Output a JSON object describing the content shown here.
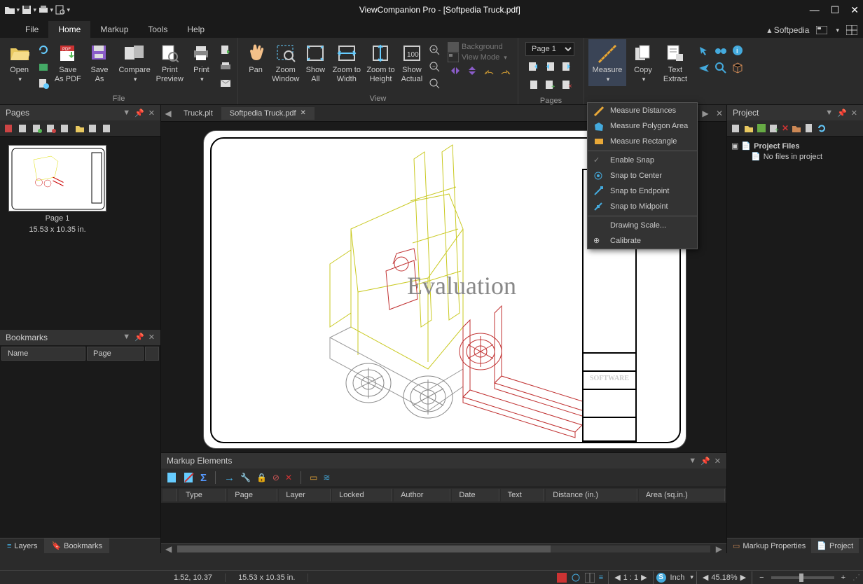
{
  "title": "ViewCompanion Pro - [Softpedia Truck.pdf]",
  "softpedia": "Softpedia",
  "menutabs": {
    "file": "File",
    "home": "Home",
    "markup": "Markup",
    "tools": "Tools",
    "help": "Help"
  },
  "ribbon": {
    "file_group": "File",
    "view_group": "View",
    "pages_group": "Pages",
    "open": "Open",
    "save_as_pdf": "Save\nAs PDF",
    "save_as": "Save\nAs",
    "compare": "Compare",
    "print_preview": "Print\nPreview",
    "print": "Print",
    "pan": "Pan",
    "zoom_window": "Zoom\nWindow",
    "show_all": "Show\nAll",
    "zoom_to_width": "Zoom to\nWidth",
    "zoom_to_height": "Zoom to\nHeight",
    "show_actual": "Show\nActual",
    "background": "Background",
    "view_mode": "View Mode",
    "page_select": "Page 1",
    "measure": "Measure",
    "copy": "Copy",
    "text_extract": "Text\nExtract"
  },
  "measure_menu": {
    "distances": "Measure Distances",
    "polygon": "Measure Polygon Area",
    "rectangle": "Measure Rectangle",
    "enable_snap": "Enable Snap",
    "snap_center": "Snap to Center",
    "snap_endpoint": "Snap to Endpoint",
    "snap_midpoint": "Snap to Midpoint",
    "drawing_scale": "Drawing Scale...",
    "calibrate": "Calibrate"
  },
  "pages_panel": {
    "title": "Pages",
    "thumb_label": "Page 1",
    "thumb_size": "15.53 x 10.35 in."
  },
  "bookmarks_panel": {
    "title": "Bookmarks",
    "col_name": "Name",
    "col_page": "Page"
  },
  "left_tabs": {
    "layers": "Layers",
    "bookmarks": "Bookmarks"
  },
  "doc_tabs": {
    "t1": "Truck.plt",
    "t2": "Softpedia Truck.pdf"
  },
  "watermark": "Evaluation",
  "titleblock": {
    "software": "SOFTWARE"
  },
  "markup_panel": {
    "title": "Markup Elements",
    "cols": {
      "type": "Type",
      "page": "Page",
      "layer": "Layer",
      "locked": "Locked",
      "author": "Author",
      "date": "Date",
      "text": "Text",
      "distance": "Distance (in.)",
      "area": "Area (sq.in.)"
    }
  },
  "project_panel": {
    "title": "Project",
    "root": "Project Files",
    "empty": "No files in project"
  },
  "right_tabs": {
    "markup_props": "Markup Properties",
    "project": "Project"
  },
  "status": {
    "coords": "1.52, 10.37",
    "size": "15.53 x 10.35 in.",
    "ratio": "1 : 1",
    "unit": "Inch",
    "zoom": "45.18%"
  }
}
